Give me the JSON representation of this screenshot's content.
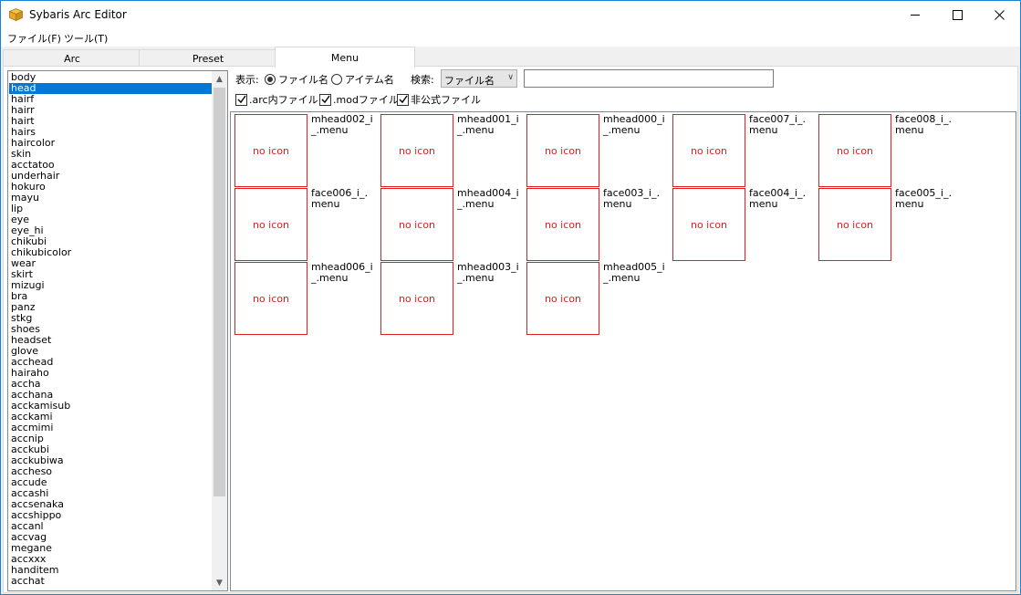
{
  "window": {
    "title": "Sybaris Arc Editor",
    "icon": "box-icon"
  },
  "menubar": {
    "items": [
      "ファイル(F)",
      "ツール(T)"
    ]
  },
  "tabs": [
    {
      "label": "Arc",
      "active": false
    },
    {
      "label": "Preset",
      "active": false
    },
    {
      "label": "Menu",
      "active": true
    }
  ],
  "category_list": {
    "selected": "head",
    "items": [
      "body",
      "head",
      "hairf",
      "hairr",
      "hairt",
      "hairs",
      "haircolor",
      "skin",
      "acctatoo",
      "underhair",
      "hokuro",
      "mayu",
      "lip",
      "eye",
      "eye_hi",
      "chikubi",
      "chikubicolor",
      "wear",
      "skirt",
      "mizugi",
      "bra",
      "panz",
      "stkg",
      "shoes",
      "headset",
      "glove",
      "acchead",
      "hairaho",
      "accha",
      "acchana",
      "acckamisub",
      "acckami",
      "accmimi",
      "accnip",
      "acckubi",
      "acckubiwa",
      "accheso",
      "accude",
      "accashi",
      "accsenaka",
      "accshippo",
      "accanl",
      "accvag",
      "megane",
      "accxxx",
      "handitem",
      "acchat"
    ]
  },
  "display": {
    "label": "表示:",
    "options": [
      {
        "label": "ファイル名",
        "checked": true
      },
      {
        "label": "アイテム名",
        "checked": false
      }
    ]
  },
  "search": {
    "label": "検索:",
    "mode_selected": "ファイル名",
    "query": "",
    "placeholder": ""
  },
  "filters": [
    {
      "label": ".arc内ファイル",
      "checked": true
    },
    {
      "label": ".modファイル",
      "checked": true
    },
    {
      "label": "非公式ファイル",
      "checked": true
    }
  ],
  "icon_placeholder_text": "no icon",
  "items": [
    {
      "name": "mhead002_i_.menu"
    },
    {
      "name": "mhead001_i_.menu"
    },
    {
      "name": "mhead000_i_.menu"
    },
    {
      "name": "face007_i_.menu"
    },
    {
      "name": "face008_i_.menu"
    },
    {
      "name": "face006_i_.menu"
    },
    {
      "name": "mhead004_i_.menu"
    },
    {
      "name": "face003_i_.menu"
    },
    {
      "name": "face004_i_.menu"
    },
    {
      "name": "face005_i_.menu"
    },
    {
      "name": "mhead006_i_.menu"
    },
    {
      "name": "mhead003_i_.menu"
    },
    {
      "name": "mhead005_i_.menu"
    }
  ],
  "colors": {
    "accent": "#0078d7",
    "noicon_border": "#e02020",
    "window_border": "#1883d7"
  }
}
